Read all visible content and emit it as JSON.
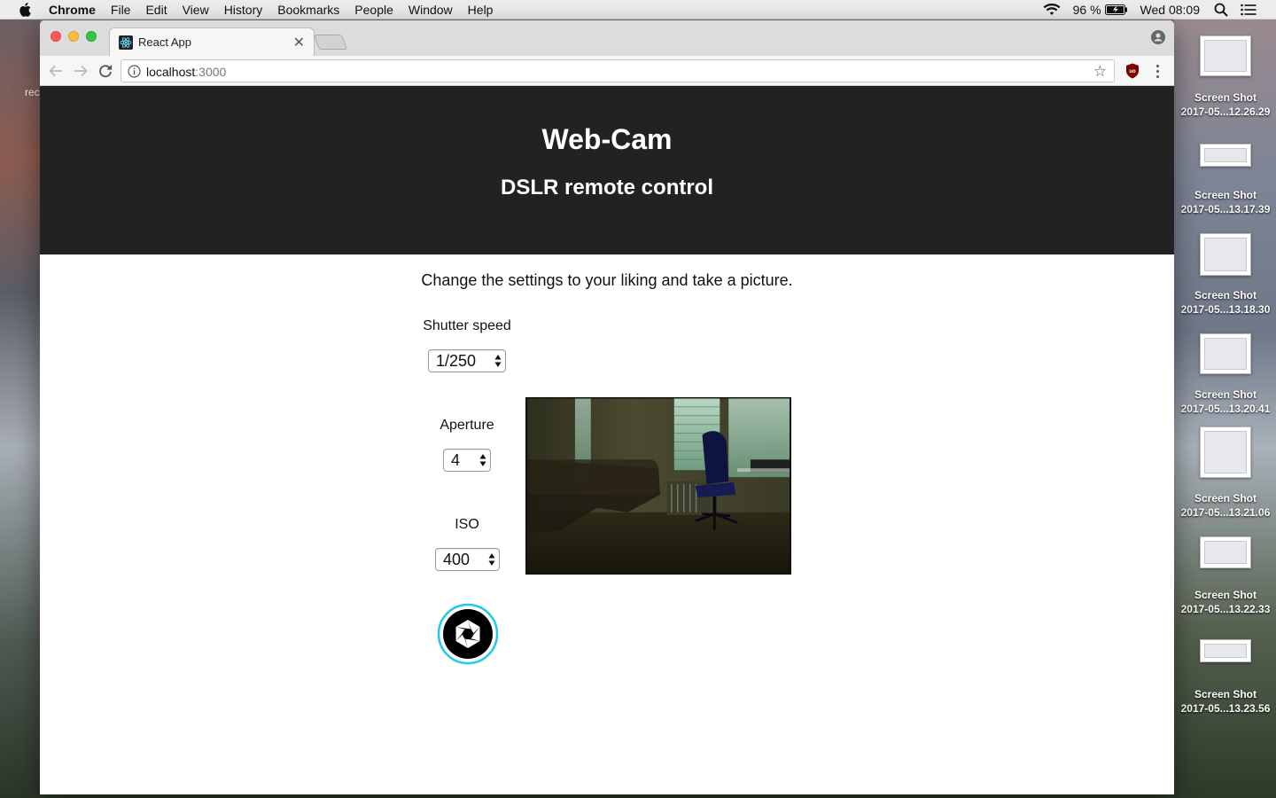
{
  "menubar": {
    "app": "Chrome",
    "items": [
      "File",
      "Edit",
      "View",
      "History",
      "Bookmarks",
      "People",
      "Window",
      "Help"
    ],
    "battery": "96 %",
    "clock": "Wed 08:09"
  },
  "desktop": {
    "left_label": "rec",
    "icons": [
      {
        "title": "Screen Shot",
        "subtitle": "2017-05...12.26.29"
      },
      {
        "title": "Screen Shot",
        "subtitle": "2017-05...13.17.39"
      },
      {
        "title": "Screen Shot",
        "subtitle": "2017-05...13.18.30"
      },
      {
        "title": "Screen Shot",
        "subtitle": "2017-05...13.20.41"
      },
      {
        "title": "Screen Shot",
        "subtitle": "2017-05...13.21.06"
      },
      {
        "title": "Screen Shot",
        "subtitle": "2017-05...13.22.33"
      },
      {
        "title": "Screen Shot",
        "subtitle": "2017-05...13.23.56"
      }
    ]
  },
  "browser": {
    "tab_title": "React App",
    "url_host": "localhost",
    "url_port": ":3000"
  },
  "page": {
    "title": "Web-Cam",
    "subtitle": "DSLR remote control",
    "intro": "Change the settings to your liking and take a picture.",
    "shutter_speed": {
      "label": "Shutter speed",
      "value": "1/250"
    },
    "aperture": {
      "label": "Aperture",
      "value": "4"
    },
    "iso": {
      "label": "ISO",
      "value": "400"
    }
  },
  "colors": {
    "header_bg": "#222222",
    "shutter_ring": "#22c8e8"
  }
}
